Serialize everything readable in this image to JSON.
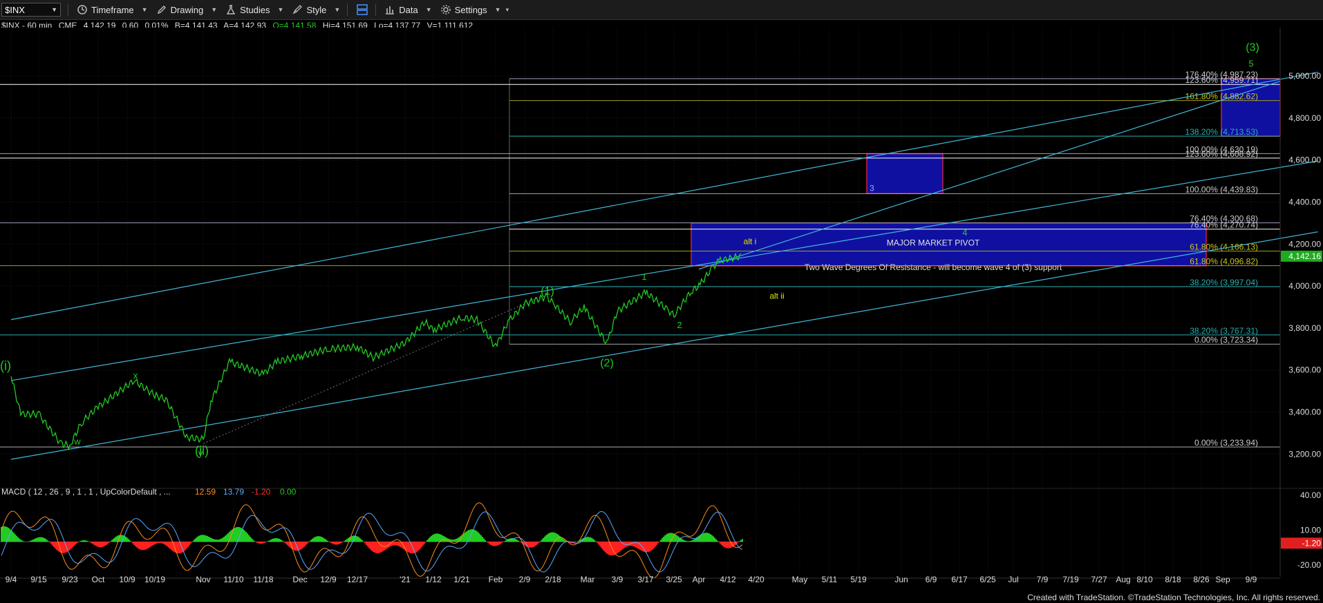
{
  "toolbar": {
    "symbol": "$INX",
    "items": [
      {
        "label": "Timeframe",
        "icon": "clock-icon"
      },
      {
        "label": "Drawing",
        "icon": "pencil-icon"
      },
      {
        "label": "Studies",
        "icon": "flask-icon"
      },
      {
        "label": "Style",
        "icon": "brush-icon"
      },
      {
        "label": "Data",
        "icon": "bar-chart-icon"
      },
      {
        "label": "Settings",
        "icon": "gear-icon"
      }
    ]
  },
  "quote": {
    "symbol": "$INX - 60 min",
    "exchange": "CME",
    "last": "4,142.19",
    "change": "0.60",
    "pct": "0.01%",
    "bid": "B=4,141.43",
    "ask": "A=4,142.93",
    "open": "O=4,141.58",
    "high": "Hi=4,151.69",
    "low": "Lo=4,137.77",
    "volume": "V=1,111,612"
  },
  "chart_data": {
    "type": "line",
    "title": "$INX - 60 min",
    "price_axis": {
      "ticks": [
        5000,
        4800,
        4600,
        4400,
        4200,
        4000,
        3800,
        3600,
        3400,
        3200
      ],
      "tick_labels": [
        "5,000.00",
        "4,800.00",
        "4,600.00",
        "4,400.00",
        "4,200.00",
        "4,000.00",
        "3,800.00",
        "3,600.00",
        "3,400.00",
        "3,200.00"
      ],
      "ylim": [
        3175,
        5230
      ],
      "current_price_label": "4,142.16"
    },
    "time_axis": {
      "tick_labels": [
        "9/4",
        "9/15",
        "9/23",
        "Oct",
        "10/9",
        "10/19",
        "Nov",
        "11/10",
        "11/18",
        "Dec",
        "12/9",
        "12/17",
        "'21",
        "1/12",
        "1/21",
        "Feb",
        "2/9",
        "2/18",
        "Mar",
        "3/9",
        "3/17",
        "3/25",
        "Apr",
        "4/12",
        "4/20",
        "May",
        "5/11",
        "5/19",
        "Jun",
        "6/9",
        "6/17",
        "6/25",
        "Jul",
        "7/9",
        "7/19",
        "7/27",
        "Aug",
        "8/10",
        "8/18",
        "8/26",
        "Sep",
        "9/9"
      ]
    },
    "price_series": {
      "name": "$INX",
      "color": "#22cc22",
      "points": [
        [
          "9/4",
          3570
        ],
        [
          "9/8",
          3390
        ],
        [
          "9/15",
          3390
        ],
        [
          "9/21",
          3250
        ],
        [
          "9/23",
          3240
        ],
        [
          "9/28",
          3350
        ],
        [
          "10/5",
          3420
        ],
        [
          "10/12",
          3550
        ],
        [
          "10/19",
          3480
        ],
        [
          "10/23",
          3460
        ],
        [
          "10/29",
          3280
        ],
        [
          "Nov",
          3270
        ],
        [
          "11/4",
          3450
        ],
        [
          "11/9",
          3640
        ],
        [
          "11/18",
          3580
        ],
        [
          "11/24",
          3640
        ],
        [
          "Dec",
          3665
        ],
        [
          "12/9",
          3700
        ],
        [
          "12/17",
          3710
        ],
        [
          "12/21",
          3660
        ],
        [
          "'21",
          3730
        ],
        [
          "1/8",
          3830
        ],
        [
          "1/12",
          3790
        ],
        [
          "1/21",
          3850
        ],
        [
          "1/26",
          3840
        ],
        [
          "Feb",
          3710
        ],
        [
          "2/3",
          3830
        ],
        [
          "2/9",
          3915
        ],
        [
          "2/16",
          3950
        ],
        [
          "2/18",
          3920
        ],
        [
          "2/25",
          3830
        ],
        [
          "3/1",
          3900
        ],
        [
          "3/4",
          3725
        ],
        [
          "3/9",
          3880
        ],
        [
          "3/17",
          3970
        ],
        [
          "3/24",
          3890
        ],
        [
          "3/25",
          3860
        ],
        [
          "3/29",
          3975
        ],
        [
          "Apr",
          4000
        ],
        [
          "4/5",
          4075
        ],
        [
          "4/9",
          4120
        ],
        [
          "4/14",
          4142
        ]
      ]
    },
    "fib_levels": [
      {
        "label": "176.40% (4,987.23)",
        "value": 4987.23
      },
      {
        "label": "123.60% (4,959.71)",
        "value": 4959.71
      },
      {
        "label": "161.80% (4,882.62)",
        "value": 4882.62
      },
      {
        "label": "138.20% (4,713.53)",
        "value": 4713.53
      },
      {
        "label": "100.00% (4,630.19)",
        "value": 4630.19
      },
      {
        "label": "123.60% (4,608.92)",
        "value": 4608.92
      },
      {
        "label": "100.00% (4,439.83)",
        "value": 4439.83
      },
      {
        "label": "76.40% (4,300.68)",
        "value": 4300.68
      },
      {
        "label": "76.40% (4,270.74)",
        "value": 4270.74
      },
      {
        "label": "61.80% (4,166.13)",
        "value": 4166.13
      },
      {
        "label": "61.80% (4,096.82)",
        "value": 4096.82
      },
      {
        "label": "38.20% (3,997.04)",
        "value": 3997.04
      },
      {
        "label": "38.20% (3,767.31)",
        "value": 3767.31
      },
      {
        "label": "0.00% (3,723.34)",
        "value": 3723.34
      },
      {
        "label": "0.00% (3,233.94)",
        "value": 3233.94
      }
    ],
    "zones": [
      {
        "label": "MAJOR MARKET PIVOT",
        "sublabel": "Two Wave Degrees Of Resistance - will become wave 4 of (3) support",
        "top": 4300,
        "bottom": 4096
      },
      {
        "label": "3",
        "top": 4630,
        "bottom": 4440
      },
      {
        "label": "",
        "top": 4987,
        "bottom": 4713
      }
    ],
    "wave_labels": [
      {
        "text": "(i)",
        "color": "#22cc22"
      },
      {
        "text": "w",
        "color": "#22cc22"
      },
      {
        "text": "x",
        "color": "#22cc22"
      },
      {
        "text": "y",
        "color": "#22cc22"
      },
      {
        "text": "(ii)",
        "color": "#22cc22"
      },
      {
        "text": "(1)",
        "color": "#22cc22"
      },
      {
        "text": "(2)",
        "color": "#22cc22"
      },
      {
        "text": "1",
        "color": "#22cc22"
      },
      {
        "text": "2",
        "color": "#22cc22"
      },
      {
        "text": "alt i",
        "color": "#e6e600"
      },
      {
        "text": "alt ii",
        "color": "#e6e600"
      },
      {
        "text": "4",
        "color": "#22cc22"
      },
      {
        "text": "(3)",
        "color": "#22cc22"
      },
      {
        "text": "5",
        "color": "#22cc22"
      }
    ],
    "macd": {
      "title": "MACD ( 12 , 26 , 9 , 1 , 1 , UpColorDefault , ...",
      "values": [
        "12.59",
        "13.79",
        "-1.20",
        "0.00"
      ],
      "value_colors": [
        "#ff8c1a",
        "#5aaaff",
        "#ff3030",
        "#22cc22"
      ],
      "axis_labels": [
        "40.00",
        "10.00",
        "-20.00"
      ],
      "current_label": "-1.20",
      "ylim": [
        -30,
        50
      ]
    }
  },
  "footer": "Created with TradeStation. ©TradeStation Technologies, Inc. All rights reserved."
}
